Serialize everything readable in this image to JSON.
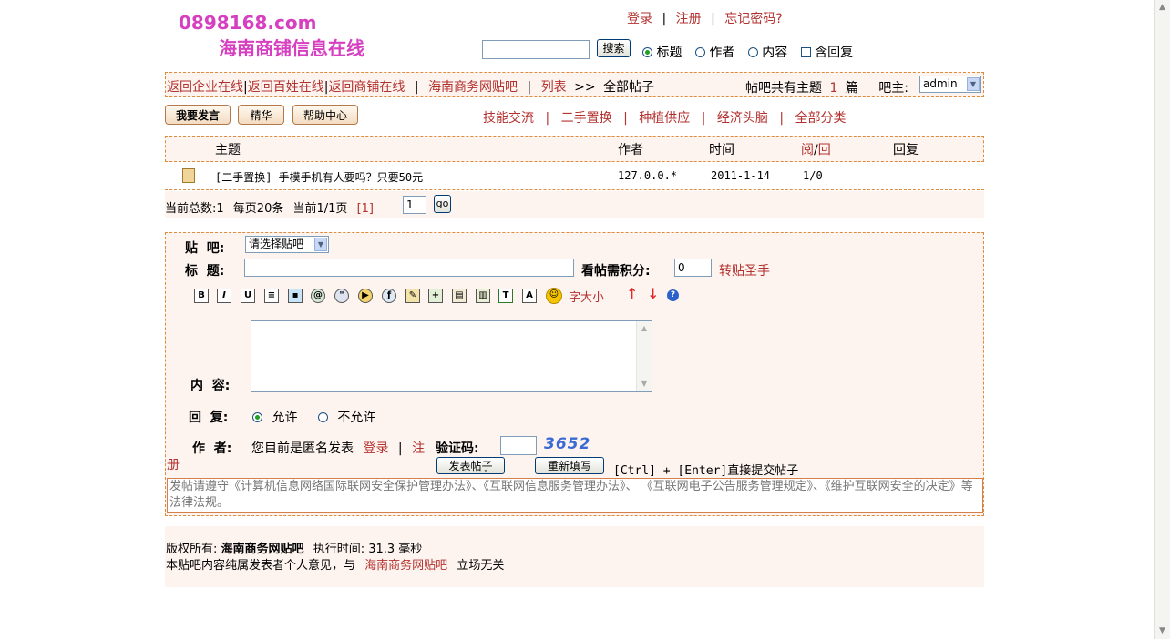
{
  "site": {
    "domain": "0898168.com",
    "name": "海南商铺信息在线"
  },
  "top_links": {
    "login": "登录",
    "register": "注册",
    "forgot": "忘记密码?",
    "sep": "|"
  },
  "search": {
    "value": "",
    "button": "搜索",
    "opt_title": "标题",
    "opt_author": "作者",
    "opt_content": "内容",
    "opt_include_reply": "含回复"
  },
  "breadcrumb": {
    "items": [
      "返回企业在线",
      "返回百姓在线",
      "返回商铺在线"
    ],
    "forum": "海南商务网贴吧",
    "list": "列表",
    "arrow": ">>",
    "current": "全部帖子"
  },
  "forum_info": {
    "topic_count_label": "帖吧共有主题",
    "topic_count": "1",
    "topic_unit": "篇",
    "owner_label": "吧主:",
    "owner_value": "admin"
  },
  "action_buttons": {
    "post": "我要发言",
    "featured": "精华",
    "help": "帮助中心"
  },
  "categories": [
    "技能交流",
    "二手置换",
    "种植供应",
    "经济头脑",
    "全部分类"
  ],
  "table": {
    "headers": {
      "subject": "主题",
      "author": "作者",
      "time": "时间",
      "read": "阅",
      "slash": "/",
      "reply_count": "回",
      "reply": "回复"
    },
    "rows": [
      {
        "subject": "[二手置换] 手模手机有人要吗？只要50元",
        "author": "127.0.0.*",
        "time": "2011-1-14",
        "reads": "1/0"
      }
    ]
  },
  "pagination": {
    "total_label": "当前总数:1",
    "per_page": "每页20条",
    "page_label": "当前1/1页",
    "page_link": "[1]",
    "page_input": "1",
    "go_button": "go"
  },
  "form": {
    "bar_label": "贴  吧:",
    "bar_select": "请选择贴吧",
    "title_label": "标  题:",
    "title_value": "",
    "points_label": "看帖需积分:",
    "points_value": "0",
    "repost_link": "转贴圣手",
    "toolbar": {
      "font_size": "字大小",
      "up": "↑",
      "down": "↓"
    },
    "content_label": "内  容:",
    "content_value": "",
    "reply_label": "回  复:",
    "reply_allow": "允许",
    "reply_disallow": "不允许",
    "author_label": "作  者:",
    "author_text": "您目前是匿名发表",
    "author_login": "登录",
    "author_sep": "|",
    "author_register_a": "注",
    "author_register_b": "册",
    "captcha_label": "验证码:",
    "captcha_value": "",
    "captcha_image_text": "3652",
    "submit_button": "发表帖子",
    "reset_button": "重新填写",
    "shortcut_hint": "[Ctrl] + [Enter]直接提交帖子"
  },
  "notice": "发帖请遵守《计算机信息网络国际联网安全保护管理办法》、《互联网信息服务管理办法》、 《互联网电子公告服务管理规定》、《维护互联网安全的决定》等法律法规。",
  "footer": {
    "copyright_label": "版权所有:",
    "copyright_owner": "海南商务网贴吧",
    "exec_time": "执行时间: 31.3 毫秒",
    "disclaimer_prefix": "本贴吧内容纯属发表者个人意见，与",
    "disclaimer_link": "海南商务网贴吧",
    "disclaimer_suffix": "立场无关"
  }
}
